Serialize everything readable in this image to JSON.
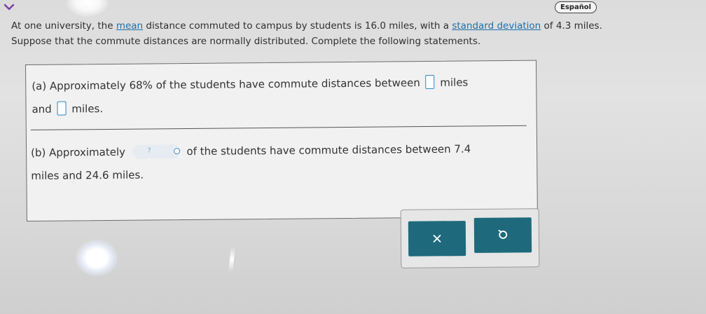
{
  "header": {
    "language_button": "Español"
  },
  "problem": {
    "line1_prefix": "At one university, the ",
    "mean_link": "mean",
    "line1_middle": " distance commuted to campus by students is 16.0 miles, with a ",
    "sd_link": "standard deviation",
    "line1_suffix": " of 4.3 miles.",
    "line2": "Suppose that the commute distances are normally distributed. Complete the following statements."
  },
  "part_a": {
    "prefix": "(a) Approximately 68% of the students have commute distances between ",
    "middle_unit": " miles",
    "line2_and": "and ",
    "suffix": " miles."
  },
  "part_b": {
    "prefix": "(b) Approximately ",
    "dropdown_placeholder": "?",
    "line1_suffix": " of the students have commute distances between 7.4",
    "line2": "miles and 24.6 miles."
  },
  "buttons": {
    "clear_symbol": "×",
    "undo_symbol": "undo"
  },
  "icons": {
    "collapse": "chevron-down-icon",
    "clear": "close-icon",
    "undo": "undo-icon"
  },
  "colors": {
    "link": "#1f6fa8",
    "answer_box_border": "#2d86c6",
    "action_button": "#1e6a7c",
    "chevron": "#7a3fa0"
  }
}
